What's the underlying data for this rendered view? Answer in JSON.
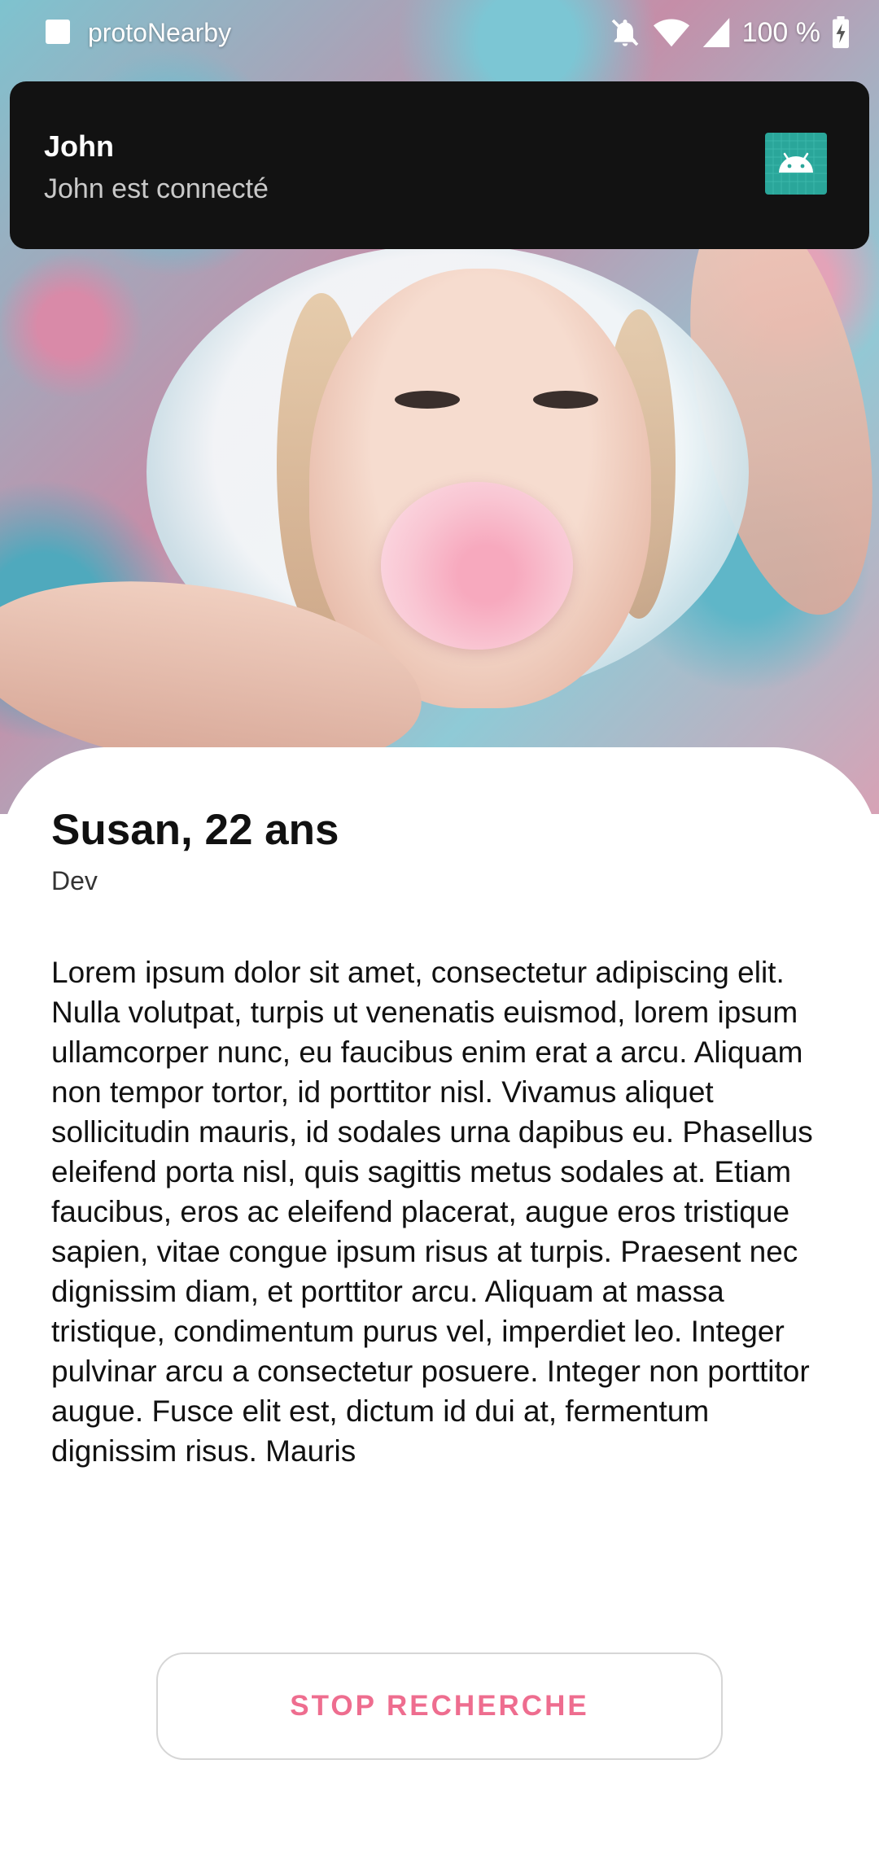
{
  "status_bar": {
    "app_name": "protoNearby",
    "battery": "100 %",
    "icons": [
      "notifications-off-icon",
      "wifi-icon",
      "signal-icon",
      "battery-charging-icon"
    ]
  },
  "notification": {
    "title": "John",
    "text": "John est connecté",
    "icon": "android-icon",
    "icon_color": "#2aa69a"
  },
  "profile": {
    "name": "Susan, 22 ans",
    "job": "Dev",
    "bio": "Lorem ipsum dolor sit amet, consectetur adipiscing elit. Nulla volutpat, turpis ut venenatis euismod, lorem ipsum ullamcorper nunc, eu faucibus enim erat a arcu. Aliquam non tempor tortor, id porttitor nisl. Vivamus aliquet sollicitudin mauris, id sodales urna dapibus eu. Phasellus eleifend porta nisl, quis sagittis metus sodales at. Etiam faucibus, eros ac eleifend placerat, augue eros tristique sapien, vitae congue ipsum risus at turpis. Praesent nec dignissim diam, et porttitor arcu. Aliquam at massa tristique, condimentum purus vel, imperdiet leo. Integer pulvinar arcu a consectetur posuere. Integer non porttitor augue. Fusce elit est, dictum id dui at, fermentum dignissim risus. Mauris"
  },
  "actions": {
    "stop_label": "STOP RECHERCHE",
    "accent_color": "#ee6d8f"
  }
}
